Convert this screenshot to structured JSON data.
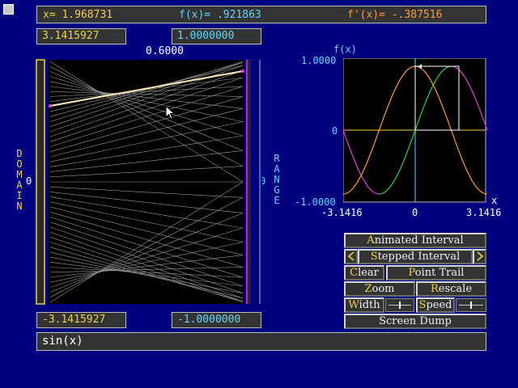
{
  "corner_icon": "square-button-icon",
  "readout": {
    "x": "x= 1.968731",
    "fx": "f(x)= .921863",
    "fpx": "f'(x)= -.387516"
  },
  "domain": {
    "label": "DOMAIN",
    "max": "3.1415927",
    "min": "-3.1415927",
    "zero": "0"
  },
  "range": {
    "label": "RANGE",
    "max": "1.0000000",
    "min": "-1.0000000",
    "zero": "0"
  },
  "current_value": "0.6000",
  "plot": {
    "ylabel": "f(x)",
    "xlabel": "x",
    "ytick_top": "1.0000",
    "ytick_mid": "0",
    "ytick_bottom": "-1.0000",
    "xtick_left": "-3.1416",
    "xtick_mid": "0",
    "xtick_right": "3.1416"
  },
  "buttons": {
    "animated_interval": {
      "hot": "A",
      "rest": "nimated Interval"
    },
    "stepped_interval": {
      "hot": "S",
      "rest": "tepped Interval"
    },
    "step_left_icon": "arrow-left-icon",
    "step_right_icon": "arrow-right-icon",
    "clear": {
      "hot": "C",
      "rest": "lear"
    },
    "point_trail": {
      "hot": "P",
      "rest": "oint Trail"
    },
    "zoom": {
      "hot": "Z",
      "rest": "oom"
    },
    "rescale": {
      "hot": "R",
      "rest": "escale"
    },
    "width": {
      "hot": "W",
      "rest": "idth"
    },
    "speed": {
      "hot": "S",
      "rest": "peed"
    },
    "screen_dump": "Screen Dump"
  },
  "function_input": "sin(x)",
  "colors": {
    "background": "#00007f",
    "panel": "#333333",
    "yellow": "#f0d44a",
    "cyan": "#5fd7ff",
    "orange": "#ff9b3b",
    "magenta": "#e040e0",
    "green": "#2fd24a"
  }
}
